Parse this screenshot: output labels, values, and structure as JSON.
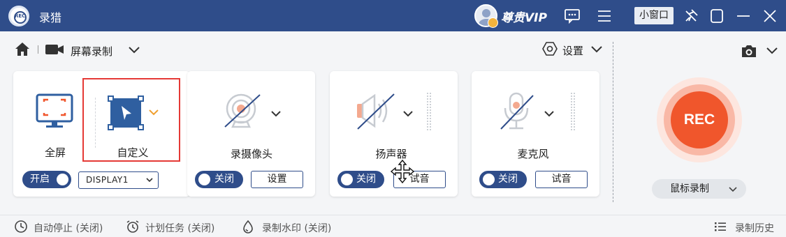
{
  "app": {
    "title": "录猎",
    "logo_text": "REC",
    "vip_label": "尊贵VIP",
    "small_window_label": "小窗口"
  },
  "toolbar": {
    "mode_label": "屏幕录制",
    "settings_label": "设置"
  },
  "cards": {
    "screen": {
      "fullscreen_label": "全屏",
      "custom_label": "自定义",
      "toggle_label": "开启",
      "display_value": "DISPLAY1"
    },
    "camera": {
      "label": "录摄像头",
      "toggle_label": "关闭",
      "button_label": "设置"
    },
    "speaker": {
      "label": "扬声器",
      "toggle_label": "关闭",
      "button_label": "试音"
    },
    "mic": {
      "label": "麦克风",
      "toggle_label": "关闭",
      "button_label": "试音"
    }
  },
  "record": {
    "rec_label": "REC",
    "mouse_mode_label": "鼠标录制"
  },
  "footer": {
    "auto_stop": "自动停止 (关闭)",
    "scheduled_task": "计划任务 (关闭)",
    "watermark": "录制水印 (关闭)",
    "history": "录制历史"
  },
  "colors": {
    "titlebar_bg": "#2f4d8a",
    "accent_orange": "#f0562c",
    "icon_blue": "#2f5fa0",
    "highlight_red": "#e53935"
  }
}
